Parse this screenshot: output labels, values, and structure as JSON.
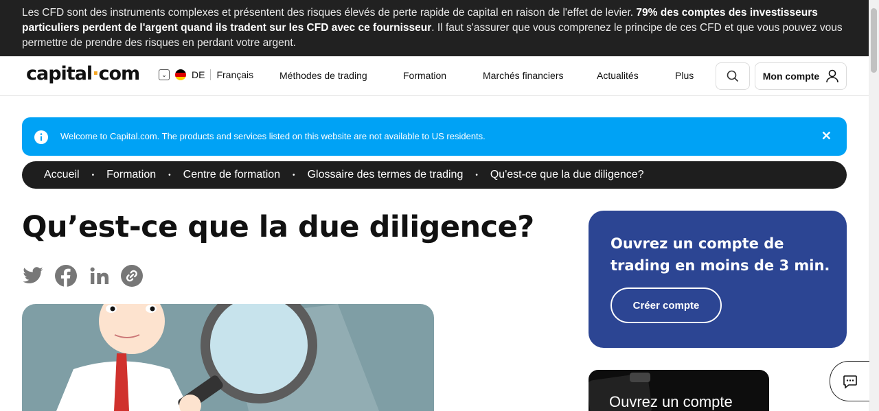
{
  "risk_warning": {
    "text_start": "Les CFD sont des instruments complexes et présentent des risques élevés de perte rapide de capital en raison de l'effet de levier. ",
    "text_bold": "79% des comptes des investisseurs particuliers perdent de l'argent quand ils tradent sur les CFD avec ce fournisseur",
    "text_end": ". Il faut s'assurer que vous comprenez le principe de ces CFD et que vous pouvez vous permettre de prendre des risques en perdant votre argent."
  },
  "header": {
    "logo_left": "capital",
    "logo_dot": "·",
    "logo_right": "com",
    "country": "DE",
    "language": "Français",
    "nav": [
      "Méthodes de trading",
      "Formation",
      "Marchés financiers",
      "Actualités",
      "Plus"
    ],
    "account_label": "Mon compte"
  },
  "notice": {
    "text": "Welcome to Capital.com. The products and services listed on this website are not available to US residents.",
    "close": "✕"
  },
  "breadcrumbs": [
    "Accueil",
    "Formation",
    "Centre de formation",
    "Glossaire des termes de trading",
    "Qu'est-ce que la due diligence?"
  ],
  "article": {
    "title": "Qu’est-ce que la due diligence?"
  },
  "cta": {
    "title": "Ouvrez un compte de trading en moins de 3 min.",
    "button": "Créer compte"
  },
  "promo": {
    "text": "Ouvrez un compte"
  },
  "colors": {
    "notice_bg": "#00a2f5",
    "cta_bg": "#2c4593",
    "logo_dot": "#f5a623"
  }
}
